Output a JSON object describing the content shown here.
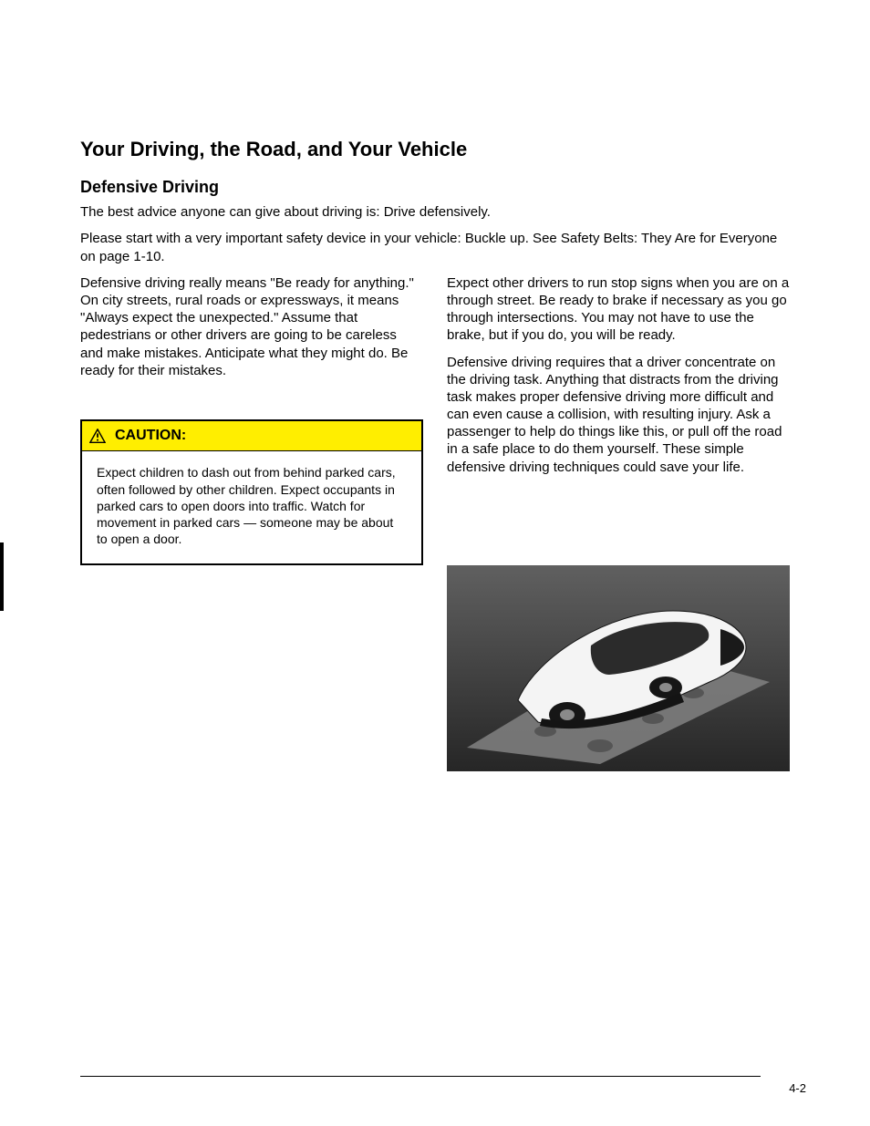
{
  "heading1": "Your Driving, the Road, and Your Vehicle",
  "heading2": "Defensive Driving",
  "intro_p1": "The best advice anyone can give about driving is: Drive defensively.",
  "intro_p2": "Please start with a very important safety device in your vehicle: Buckle up. See Safety Belts: They Are for Everyone on page 1-10.",
  "left_body": "Defensive driving really means \"Be ready for anything.\" On city streets, rural roads or expressways, it means \"Always expect the unexpected.\" Assume that pedestrians or other drivers are going to be careless and make mistakes. Anticipate what they might do. Be ready for their mistakes.",
  "caution_label": "CAUTION:",
  "caution_body": "Expect children to dash out from behind parked cars, often followed by other children. Expect occupants in parked cars to open doors into traffic. Watch for movement in parked cars — someone may be about to open a door.",
  "right_p1": "Expect other drivers to run stop signs when you are on a through street. Be ready to brake if necessary as you go through intersections. You may not have to use the brake, but if you do, you will be ready.",
  "right_p2": "Defensive driving requires that a driver concentrate on the driving task. Anything that distracts from the driving task makes proper defensive driving more difficult and can even cause a collision, with resulting injury. Ask a passenger to help do things like this, or pull off the road in a safe place to do them yourself. These simple defensive driving techniques could save your life.",
  "page_number": "4-2"
}
